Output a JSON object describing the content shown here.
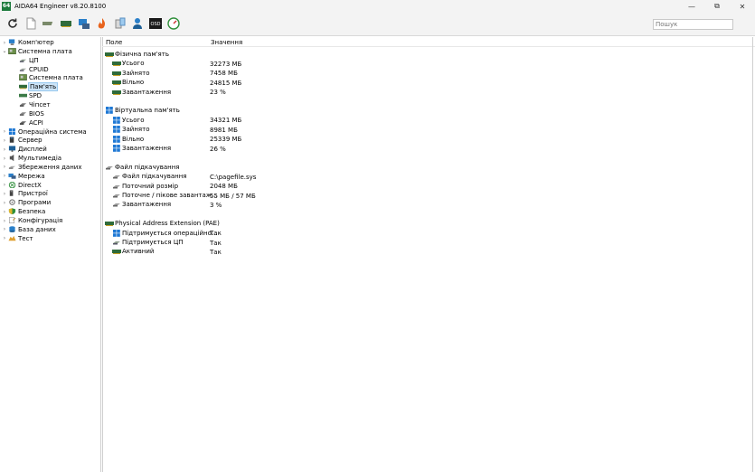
{
  "window": {
    "logo": "64",
    "title": "AIDA64 Engineer v8.20.8100",
    "minimize": "—",
    "maximize": "⧉",
    "close": "✕"
  },
  "toolbar": {
    "icons": [
      "refresh-icon",
      "report-icon",
      "motherboard-icon",
      "memory-icon",
      "network-icon",
      "flame-icon",
      "cache-icon",
      "user-icon",
      "osd-icon",
      "gauge-icon"
    ],
    "search_placeholder": "Пошук"
  },
  "tree": {
    "items": [
      {
        "label": "Комп'ютер",
        "level": 0,
        "chevron": "›",
        "icon": "computer-icon"
      },
      {
        "label": "Системна плата",
        "level": 0,
        "chevron": "⌄",
        "icon": "motherboard-icon"
      },
      {
        "label": "ЦП",
        "level": 1,
        "icon": "cpu-icon"
      },
      {
        "label": "CPUID",
        "level": 1,
        "icon": "cpuid-icon"
      },
      {
        "label": "Системна плата",
        "level": 1,
        "icon": "motherboard-icon"
      },
      {
        "label": "Пам'ять",
        "level": 1,
        "icon": "memory-icon",
        "selected": true
      },
      {
        "label": "SPD",
        "level": 1,
        "icon": "spd-icon"
      },
      {
        "label": "Чіпсет",
        "level": 1,
        "icon": "chipset-icon"
      },
      {
        "label": "BIOS",
        "level": 1,
        "icon": "bios-icon"
      },
      {
        "label": "ACPI",
        "level": 1,
        "icon": "acpi-icon"
      },
      {
        "label": "Операційна система",
        "level": 0,
        "chevron": "›",
        "icon": "windows-icon"
      },
      {
        "label": "Сервер",
        "level": 0,
        "chevron": "›",
        "icon": "server-icon"
      },
      {
        "label": "Дисплей",
        "level": 0,
        "chevron": "›",
        "icon": "display-icon"
      },
      {
        "label": "Мультимедіа",
        "level": 0,
        "chevron": "›",
        "icon": "multimedia-icon"
      },
      {
        "label": "Збереження даних",
        "level": 0,
        "chevron": "›",
        "icon": "storage-icon"
      },
      {
        "label": "Мережа",
        "level": 0,
        "chevron": "›",
        "icon": "network-icon"
      },
      {
        "label": "DirectX",
        "level": 0,
        "chevron": "›",
        "icon": "xbox-icon"
      },
      {
        "label": "Пристрої",
        "level": 0,
        "chevron": "›",
        "icon": "devices-icon"
      },
      {
        "label": "Програми",
        "level": 0,
        "chevron": "›",
        "icon": "programs-icon"
      },
      {
        "label": "Безпека",
        "level": 0,
        "chevron": "›",
        "icon": "security-icon"
      },
      {
        "label": "Конфігурація",
        "level": 0,
        "chevron": "›",
        "icon": "config-icon"
      },
      {
        "label": "База даних",
        "level": 0,
        "chevron": "›",
        "icon": "database-icon"
      },
      {
        "label": "Тест",
        "level": 0,
        "chevron": "›",
        "icon": "test-icon"
      }
    ]
  },
  "table": {
    "col_field": "Поле",
    "col_value": "Значення",
    "rows": [
      {
        "type": "group",
        "label": "Фізична пам'ять",
        "icon": "memory-icon"
      },
      {
        "type": "item",
        "label": "Усього",
        "value": "32273 МБ",
        "icon": "memory-icon"
      },
      {
        "type": "item",
        "label": "Зайнято",
        "value": "7458 МБ",
        "icon": "memory-icon"
      },
      {
        "type": "item",
        "label": "Вільно",
        "value": "24815 МБ",
        "icon": "memory-icon"
      },
      {
        "type": "item",
        "label": "Завантаження",
        "value": "23 %",
        "icon": "memory-icon"
      },
      {
        "type": "spacer"
      },
      {
        "type": "group",
        "label": "Віртуальна пам'ять",
        "icon": "windows-icon"
      },
      {
        "type": "item",
        "label": "Усього",
        "value": "34321 МБ",
        "icon": "windows-icon"
      },
      {
        "type": "item",
        "label": "Зайнято",
        "value": "8981 МБ",
        "icon": "windows-icon"
      },
      {
        "type": "item",
        "label": "Вільно",
        "value": "25339 МБ",
        "icon": "windows-icon"
      },
      {
        "type": "item",
        "label": "Завантаження",
        "value": "26 %",
        "icon": "windows-icon"
      },
      {
        "type": "spacer"
      },
      {
        "type": "group",
        "label": "Файл підкачування",
        "icon": "disk-icon"
      },
      {
        "type": "item",
        "label": "Файл підкачування",
        "value": "C:\\pagefile.sys",
        "icon": "disk-icon"
      },
      {
        "type": "item",
        "label": "Поточний розмір",
        "value": "2048 МБ",
        "icon": "disk-icon"
      },
      {
        "type": "item",
        "label": "Поточне / пікове завантаж...",
        "value": "55 МБ / 57 МБ",
        "icon": "disk-icon"
      },
      {
        "type": "item",
        "label": "Завантаження",
        "value": "3 %",
        "icon": "disk-icon"
      },
      {
        "type": "spacer"
      },
      {
        "type": "group",
        "label": "Physical Address Extension (PAE)",
        "icon": "memory-icon"
      },
      {
        "type": "item",
        "label": "Підтримується операційно...",
        "value": "Так",
        "icon": "windows-icon"
      },
      {
        "type": "item",
        "label": "Підтримується ЦП",
        "value": "Так",
        "icon": "cpu-icon"
      },
      {
        "type": "item",
        "label": "Активний",
        "value": "Так",
        "icon": "memory-icon"
      }
    ]
  },
  "colors": {
    "selection": "#cce4f7",
    "memory_green": "#2f6b3a",
    "windows_blue": "#1e78d4",
    "chrome": "#f3f3f3"
  }
}
